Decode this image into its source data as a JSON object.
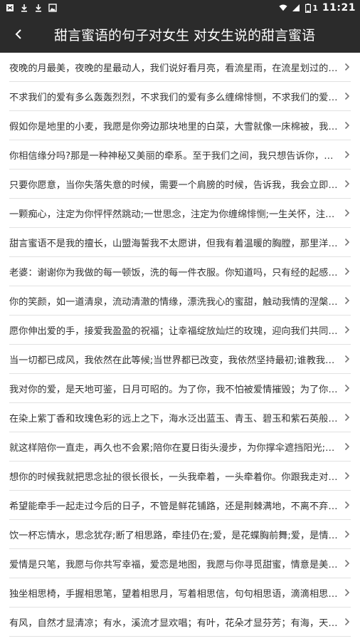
{
  "status_bar": {
    "time": "11:21",
    "battery_level": "1",
    "left_icons": [
      "notification-icon",
      "download-icon",
      "download-icon",
      "image-icon"
    ],
    "right_icons": [
      "wifi-icon",
      "signal-icon",
      "battery-icon"
    ]
  },
  "app_bar": {
    "title": "甜言蜜语的句子对女生 对女生说的甜言蜜语",
    "back_icon": "back-icon"
  },
  "list": {
    "items": [
      {
        "text": "夜晚的月最美，夜晚的星最动人，我们说好看月亮，看流星雨，在流星划过的…"
      },
      {
        "text": "不求我们的爱有多么轰轰烈烈，不求我们的爱有多么缠绵悱恻，不求我们的爱…"
      },
      {
        "text": "假如你是地里的小麦，我愿是你旁边那块地里的白菜，大雪就像一床棉被，我…"
      },
      {
        "text": "你相信缘分吗?那是一种神秘又美丽的牵系。至于我们之间，我只想告诉你，我…"
      },
      {
        "text": "只要你愿意，当你失落失意的时候，需要一个肩膀的时候，告诉我，我会立即…"
      },
      {
        "text": "一颗痴心，注定为你怦怦然跳动;一世思念，注定为你缠绵悱恻;一生关怀，注定…"
      },
      {
        "text": "甜言蜜语不是我的擅长，山盟海誓我不太愿讲，但我有着温暖的胸膛，那里洋…"
      },
      {
        "text": "老婆：谢谢你为我做的每一顿饭，洗的每一件衣服。你知道吗，只有经的起感…"
      },
      {
        "text": "你的笑颜，如一道清泉，流动清澈的情缘，漂洗我心的蜜甜，触动我情的涅槃…"
      },
      {
        "text": "愿你伸出爱的手，接爱我盈盈的祝福；让幸福绽放灿烂的玫瑰，迎向我们共同…"
      },
      {
        "text": "当一切都已成风，我依然在此等候;当世界都已改变，我依然坚持最初;谁教我是…"
      },
      {
        "text": "我对你的爱，是天地可鉴，日月可昭的。为了你，我不怕被爱情摧毁；为了你…"
      },
      {
        "text": "在染上紫丁香和玫瑰色彩的远上之下，海水泛出蓝玉、青玉、碧玉和紫石英般…"
      },
      {
        "text": "就这样陪你一直走，再久也不会累;陪你在夏日街头漫步，为你撑伞遮挡阳光;为…"
      },
      {
        "text": "想你的时候我就把思念扯的很长很长，一头我牵着，一头牵着你。你跟我走对…"
      },
      {
        "text": "希望能牵手一起走过今后的日子，不管是鲜花铺路，还是荆棘满地，不离不弃…"
      },
      {
        "text": "饮一杯忘情水，思念犹存;断了相思路，牵挂仍在;爱，是花蝶胸前舞;爱，是情…"
      },
      {
        "text": "爱情是只笔，我愿与你共写幸福，爱恋是地图，我愿与你寻觅甜蜜，情意是美…"
      },
      {
        "text": "独坐相思椅，手握相思笔，望着相思月，写着相思信，句句相思语，滴滴相思…"
      },
      {
        "text": "有风，自然才显清凉；有水，溪流才显欢唱；有叶，花朵才显芬芳；有海，天…"
      }
    ]
  }
}
